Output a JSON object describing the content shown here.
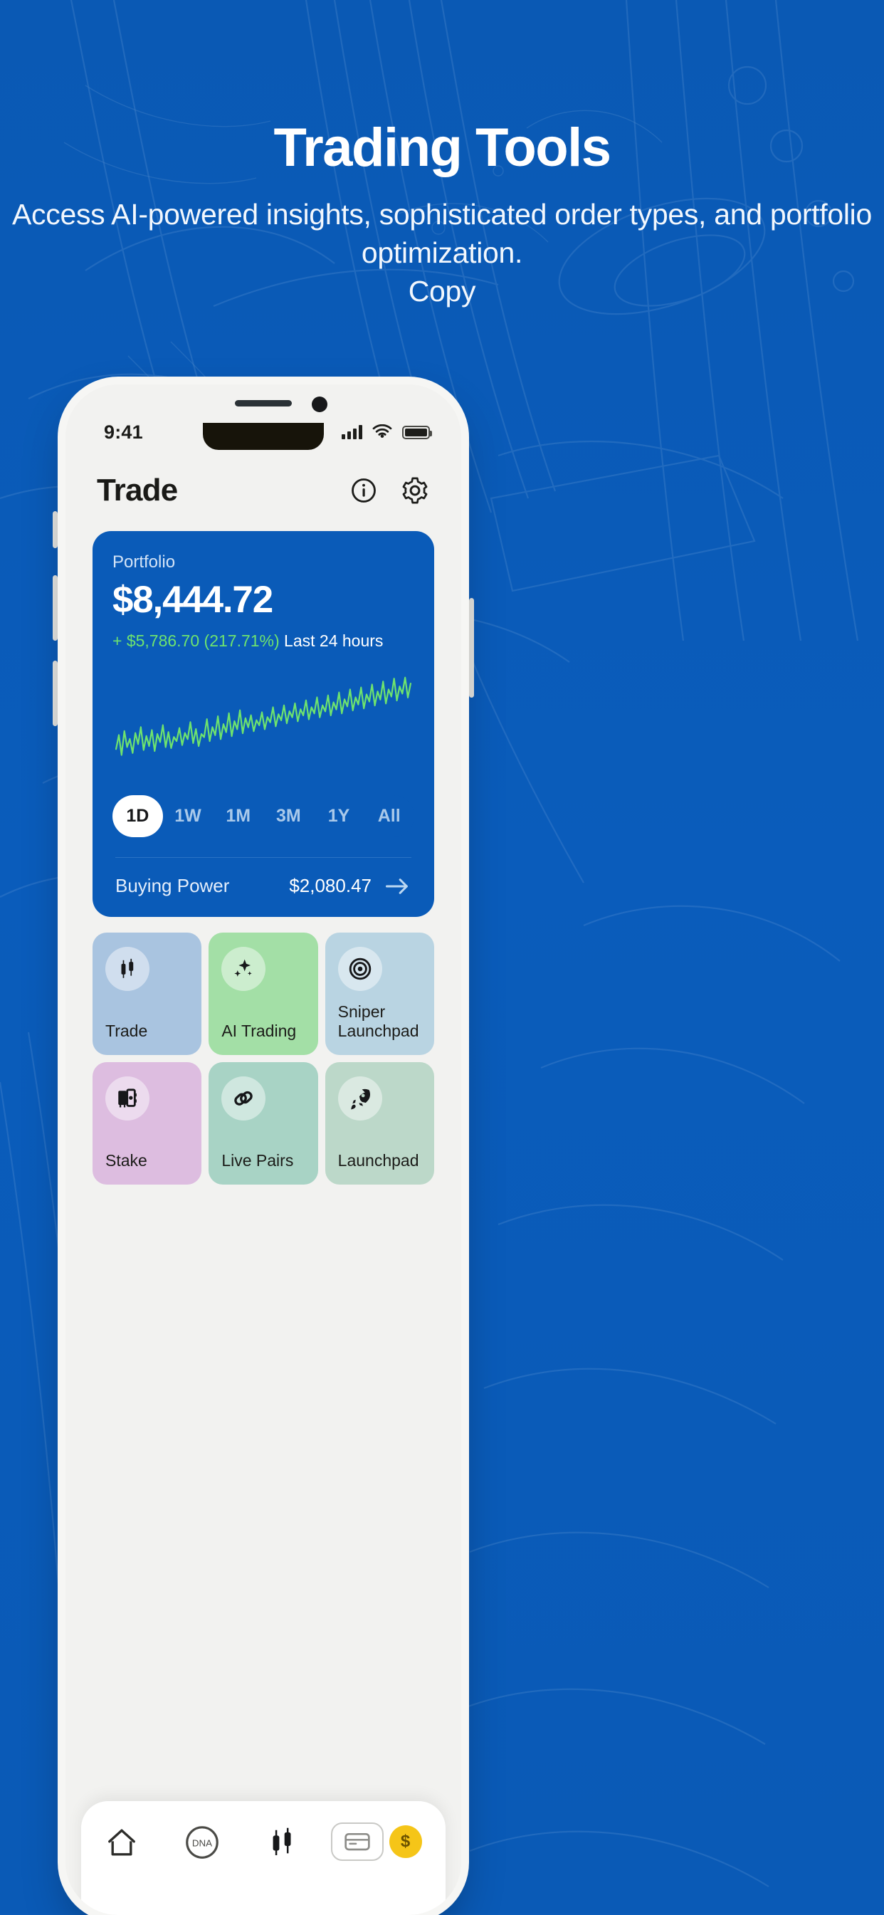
{
  "hero": {
    "title": "Trading Tools",
    "subtitle": "Access AI-powered insights, sophisticated order types, and portfolio optimization.\nCopy"
  },
  "colors": {
    "brand_blue": "#0a5bb8",
    "background_blue": "#0c5cb8",
    "gain_green": "#6ee36e",
    "chart_green": "#6ee36e"
  },
  "phone": {
    "statusbar": {
      "time": "9:41",
      "signal_icon": "cellular-bars-icon",
      "wifi_icon": "wifi-icon",
      "battery_icon": "battery-icon"
    },
    "header": {
      "title": "Trade",
      "info_icon": "info-circle-icon",
      "settings_icon": "gear-icon"
    },
    "portfolio": {
      "label": "Portfolio",
      "value": "$8,444.72",
      "change_amount": "+ $5,786.70 (217.71%)",
      "change_period": "Last 24 hours",
      "ranges": [
        "1D",
        "1W",
        "1M",
        "3M",
        "1Y",
        "All"
      ],
      "active_range": "1D",
      "buying_power_label": "Buying Power",
      "buying_power_value": "$2,080.47",
      "buying_power_arrow_icon": "arrow-right-icon"
    },
    "tiles": [
      {
        "label": "Trade",
        "icon": "candlestick-icon",
        "bg": "#a9c4e0",
        "icon_bg": "rgba(255,255,255,0.45)"
      },
      {
        "label": "AI Trading",
        "icon": "sparkles-icon",
        "bg": "#a3dfa6",
        "icon_bg": "rgba(255,255,255,0.45)"
      },
      {
        "label": "Sniper Launchpad",
        "icon": "target-icon",
        "bg": "#b9d4e2",
        "icon_bg": "rgba(255,255,255,0.45)"
      },
      {
        "label": "Stake",
        "icon": "safe-vault-icon",
        "bg": "#ddbde0",
        "icon_bg": "rgba(255,255,255,0.45)"
      },
      {
        "label": "Live Pairs",
        "icon": "link-chain-icon",
        "bg": "#a8d3c5",
        "icon_bg": "rgba(255,255,255,0.45)"
      },
      {
        "label": "Launchpad",
        "icon": "rocket-icon",
        "bg": "#bcd8c9",
        "icon_bg": "rgba(255,255,255,0.45)"
      }
    ],
    "bottom_nav": [
      {
        "icon": "home-icon",
        "label": ""
      },
      {
        "icon": "dna-icon",
        "label": ""
      },
      {
        "icon": "candles-icon",
        "label": ""
      },
      {
        "icon": "wallet-icon",
        "label": ""
      }
    ]
  },
  "chart_data": {
    "type": "line",
    "title": "Portfolio value, last 24 hours",
    "xlabel": "",
    "ylabel": "",
    "series": [
      {
        "name": "Portfolio",
        "color": "#6ee36e",
        "values": [
          28,
          42,
          22,
          46,
          30,
          38,
          24,
          44,
          33,
          50,
          27,
          41,
          31,
          47,
          26,
          43,
          35,
          52,
          30,
          45,
          29,
          40,
          36,
          49,
          32,
          44,
          38,
          55,
          34,
          48,
          31,
          43,
          40,
          58,
          36,
          50,
          42,
          61,
          38,
          53,
          45,
          64,
          41,
          56,
          48,
          67,
          44,
          59,
          50,
          62,
          46,
          57,
          52,
          65,
          48,
          60,
          55,
          70,
          51,
          63,
          57,
          72,
          54,
          66,
          60,
          74,
          56,
          68,
          62,
          77,
          58,
          70,
          64,
          80,
          60,
          72,
          66,
          82,
          62,
          75,
          68,
          85,
          64,
          78,
          71,
          88,
          67,
          80,
          73,
          90,
          69,
          83,
          76,
          93,
          72,
          86,
          78,
          96,
          74,
          88,
          81,
          99,
          77,
          91,
          84,
          100,
          80,
          94
        ]
      }
    ],
    "ylim": [
      0,
      110
    ],
    "grid": false,
    "legend": "none"
  }
}
